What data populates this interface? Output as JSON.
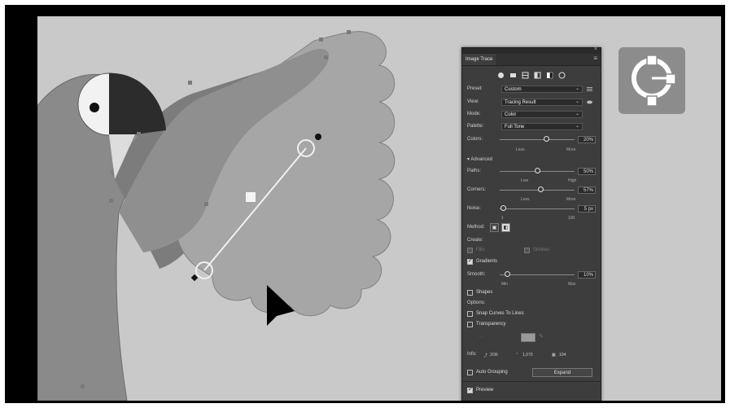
{
  "panel": {
    "title": "Image Trace",
    "menu_icon": "menu-icon",
    "close_icon": "close-icon",
    "preset_icons": [
      "auto-color-icon",
      "high-color-icon",
      "low-color-icon",
      "grayscale-icon",
      "black-white-icon",
      "outline-icon"
    ],
    "preset": {
      "label": "Preset:",
      "value": "Custom"
    },
    "view": {
      "label": "View:",
      "value": "Tracing Result"
    },
    "mode": {
      "label": "Mode:",
      "value": "Color"
    },
    "palette": {
      "label": "Palette:",
      "value": "Full Tone"
    },
    "colors": {
      "label": "Colors:",
      "value": "20%",
      "level": 0.62,
      "min": "Less",
      "max": "More"
    },
    "advanced_label": "Advanced",
    "paths": {
      "label": "Paths:",
      "value": "50%",
      "level": 0.5,
      "min": "Low",
      "max": "High"
    },
    "corners": {
      "label": "Corners:",
      "value": "57%",
      "level": 0.55,
      "min": "Less",
      "max": "More"
    },
    "noise": {
      "label": "Noise:",
      "value": "5 px",
      "level": 0.05,
      "min": "1",
      "max": "100"
    },
    "method_label": "Method:",
    "create_label": "Create:",
    "fills_label": "Fills",
    "strokes_label": "Strokes",
    "gradients_label": "Gradients",
    "smooth": {
      "label": "Smooth:",
      "value": "10%",
      "level": 0.1,
      "min": "Min",
      "max": "Max"
    },
    "shapes_label": "Shapes",
    "options_label": "Options:",
    "snap_curves_label": "Snap Curves To Lines",
    "transparency_label": "Transparency",
    "stats": {
      "label": "Info:",
      "paths": "2/36",
      "anchors": "1,070",
      "colors": "104"
    },
    "auto_grouping_label": "Auto Grouping",
    "expand_label": "Expand",
    "preview_label": "Preview"
  }
}
